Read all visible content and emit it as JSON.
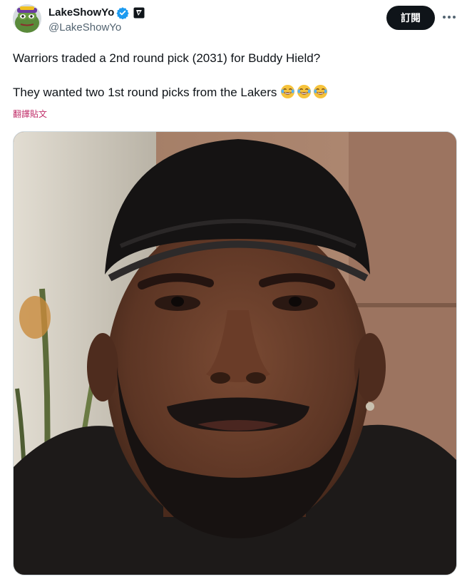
{
  "tweet": {
    "author": {
      "display_name": "LakeShowYo",
      "handle": "@LakeShowYo",
      "verified": true,
      "avatar": "frog-avatar"
    },
    "subscribe_label": "訂閱",
    "more_icon": "more-icon",
    "text_line1": "Warriors traded a 2nd round pick (2031) for Buddy Hield?",
    "text_line2": "They wanted two 1st round picks from the Lakers",
    "emojis": [
      "face-with-tears-of-joy",
      "face-with-tears-of-joy",
      "face-with-tears-of-joy"
    ],
    "translate_label": "翻譯貼文",
    "media": {
      "type": "photo",
      "subject": "selfie-portrait"
    }
  },
  "colors": {
    "text_primary": "#0f1419",
    "text_secondary": "#536471",
    "button_bg": "#0f1419",
    "verified": "#1d9bf0",
    "translate_link": "#c0306a"
  }
}
